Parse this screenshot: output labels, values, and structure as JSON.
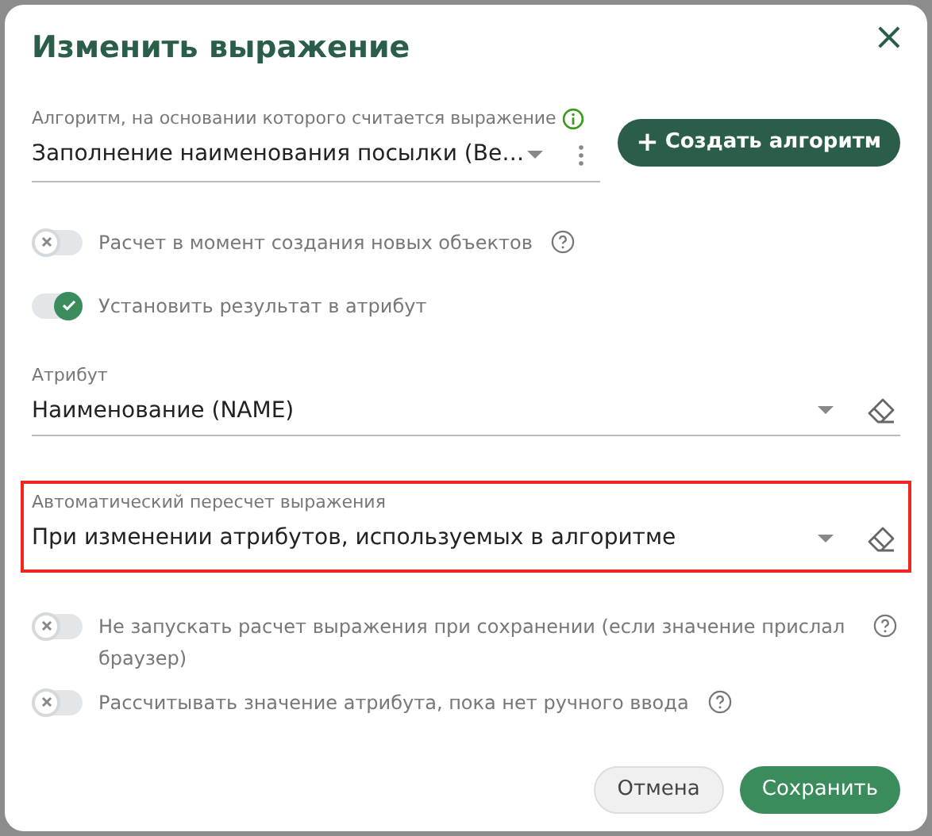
{
  "dialog": {
    "title": "Изменить выражение",
    "close": "×"
  },
  "algorithm": {
    "label": "Алгоритм, на основании которого считается выражение",
    "value": "Заполнение наименования посылки (Ве…",
    "info": true
  },
  "create_button": {
    "icon": "+",
    "label": "Создать алгоритм"
  },
  "options_top": [
    {
      "label": "Расчет в момент создания новых объектов",
      "on": false,
      "help": true
    },
    {
      "label": "Установить результат в атрибут",
      "on": true,
      "help": false
    }
  ],
  "fields": [
    {
      "label": "Атрибут",
      "value": "Наименование (NAME)",
      "highlighted": false
    },
    {
      "label": "Автоматический пересчет выражения",
      "value": "При изменении атрибутов, используемых в алгоритме",
      "highlighted": true
    }
  ],
  "options_bottom": [
    {
      "label": "Не запускать расчет выражения при сохранении (если значение прислал браузер)",
      "on": false,
      "help": true
    },
    {
      "label": "Рассчитывать значение атрибута, пока нет ручного ввода",
      "on": false,
      "help": true
    }
  ],
  "buttons": [
    {
      "label": "Отмена",
      "kind": "secondary"
    },
    {
      "label": "Сохранить",
      "kind": "primary"
    }
  ]
}
